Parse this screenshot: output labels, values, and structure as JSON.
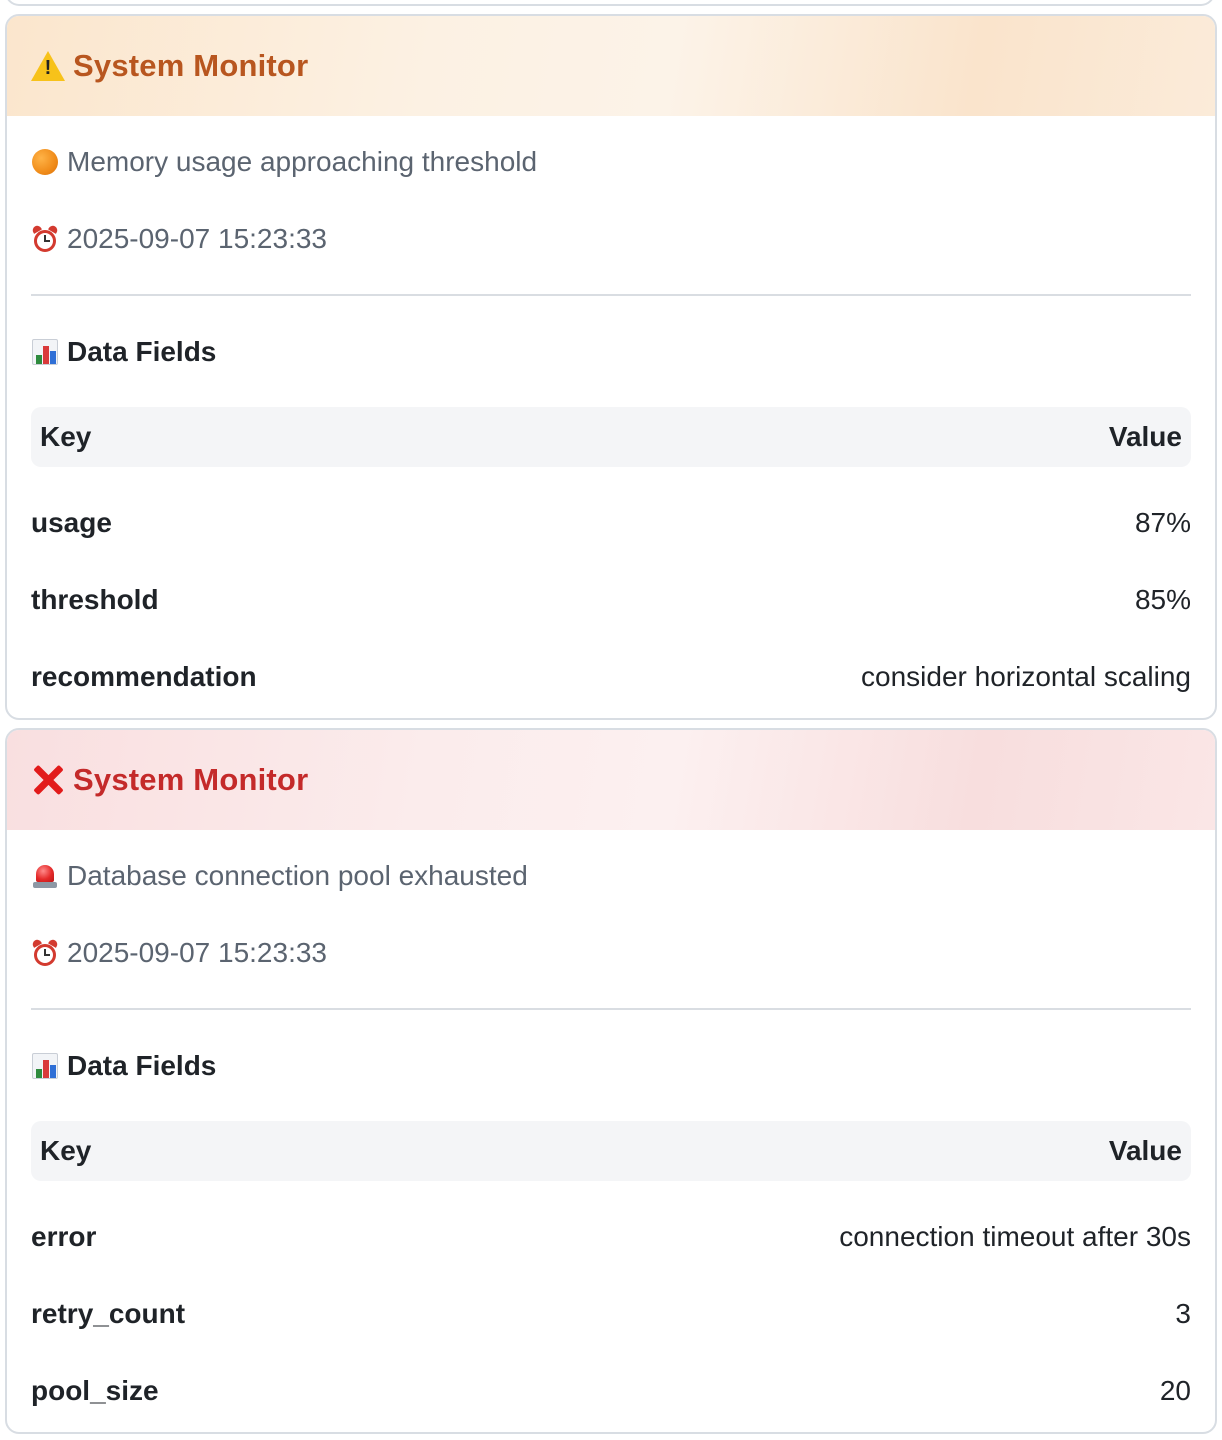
{
  "cards": [
    {
      "variant": "warning",
      "header_icon": "warning-icon",
      "title": "System Monitor",
      "message_icon": "orange-circle-icon",
      "message": "Memory usage approaching threshold",
      "time_icon": "alarm-clock-icon",
      "timestamp": "2025-09-07 15:23:33",
      "fields_icon": "bar-chart-icon",
      "fields_heading": "Data Fields",
      "table": {
        "key_header": "Key",
        "value_header": "Value",
        "rows": [
          {
            "key": "usage",
            "value": "87%"
          },
          {
            "key": "threshold",
            "value": "85%"
          },
          {
            "key": "recommendation",
            "value": "consider horizontal scaling"
          }
        ]
      },
      "colors": {
        "title": "#b8561f",
        "header_bg": "#fcf1e3"
      }
    },
    {
      "variant": "error",
      "header_icon": "cross-mark-icon",
      "title": "System Monitor",
      "message_icon": "siren-icon",
      "message": "Database connection pool exhausted",
      "time_icon": "alarm-clock-icon",
      "timestamp": "2025-09-07 15:23:33",
      "fields_icon": "bar-chart-icon",
      "fields_heading": "Data Fields",
      "table": {
        "key_header": "Key",
        "value_header": "Value",
        "rows": [
          {
            "key": "error",
            "value": "connection timeout after 30s"
          },
          {
            "key": "retry_count",
            "value": "3"
          },
          {
            "key": "pool_size",
            "value": "20"
          }
        ]
      },
      "colors": {
        "title": "#c42a2a",
        "header_bg": "#fbecec"
      }
    }
  ]
}
